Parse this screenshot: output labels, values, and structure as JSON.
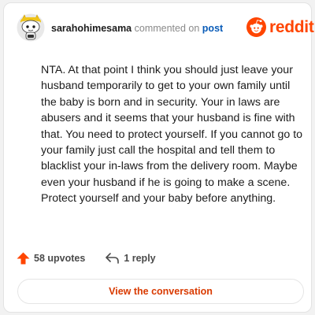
{
  "comment": {
    "author": "sarahohimesama",
    "action_text": "commented on",
    "post_link": "post",
    "body": "NTA. At that point I think you should just leave your husband temporarily to get to your own family until the baby is born and in security. Your in laws are abusers and it seems that your husband is fine with that. You need to protect yourself. If you cannot go to your family just call the hospital and tell them to blacklist your in-laws from the delivery room. Maybe even your husband if he is going to make a scene. Protect yourself and your baby before anything.",
    "upvotes": "58 upvotes",
    "replies": "1 reply"
  },
  "brand": {
    "name": "reddit",
    "color": "#ff4500",
    "logo_icon": "reddit-snoo-icon"
  },
  "actions": {
    "view_conversation": "View the conversation"
  },
  "icons": {
    "upvote": "upvote-arrow-icon",
    "reply": "reply-arrow-icon",
    "avatar": "user-avatar"
  },
  "colors": {
    "link": "#0a5cb8",
    "accent": "#d93a00",
    "upvote": "#ff4500"
  }
}
